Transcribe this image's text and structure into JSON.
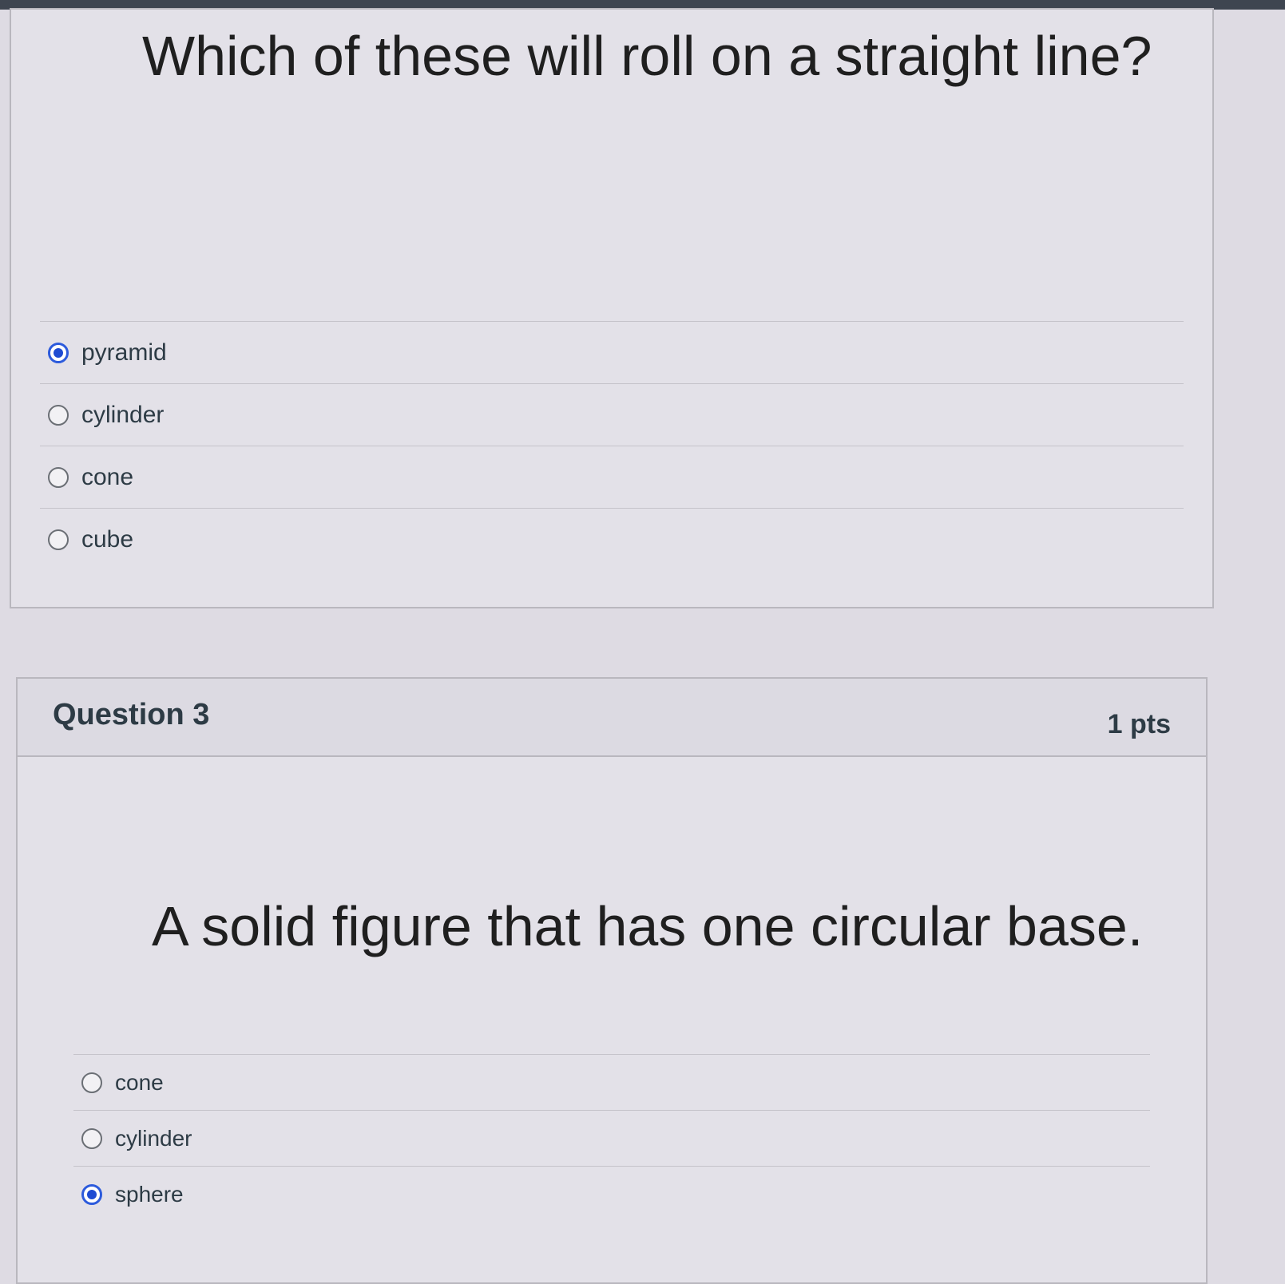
{
  "question_2": {
    "text": "Which of these will roll on a straight line?",
    "answers": [
      {
        "label": "pyramid",
        "selected": true
      },
      {
        "label": "cylinder",
        "selected": false
      },
      {
        "label": "cone",
        "selected": false
      },
      {
        "label": "cube",
        "selected": false
      }
    ]
  },
  "question_3": {
    "title": "Question 3",
    "points": "1 pts",
    "text": "A solid figure that has one circular base.",
    "answers": [
      {
        "label": "cone",
        "selected": false
      },
      {
        "label": "cylinder",
        "selected": false
      },
      {
        "label": "sphere",
        "selected": true
      }
    ]
  },
  "colors": {
    "radio_selected": "#1e4bd2",
    "text": "#2d3b45"
  }
}
